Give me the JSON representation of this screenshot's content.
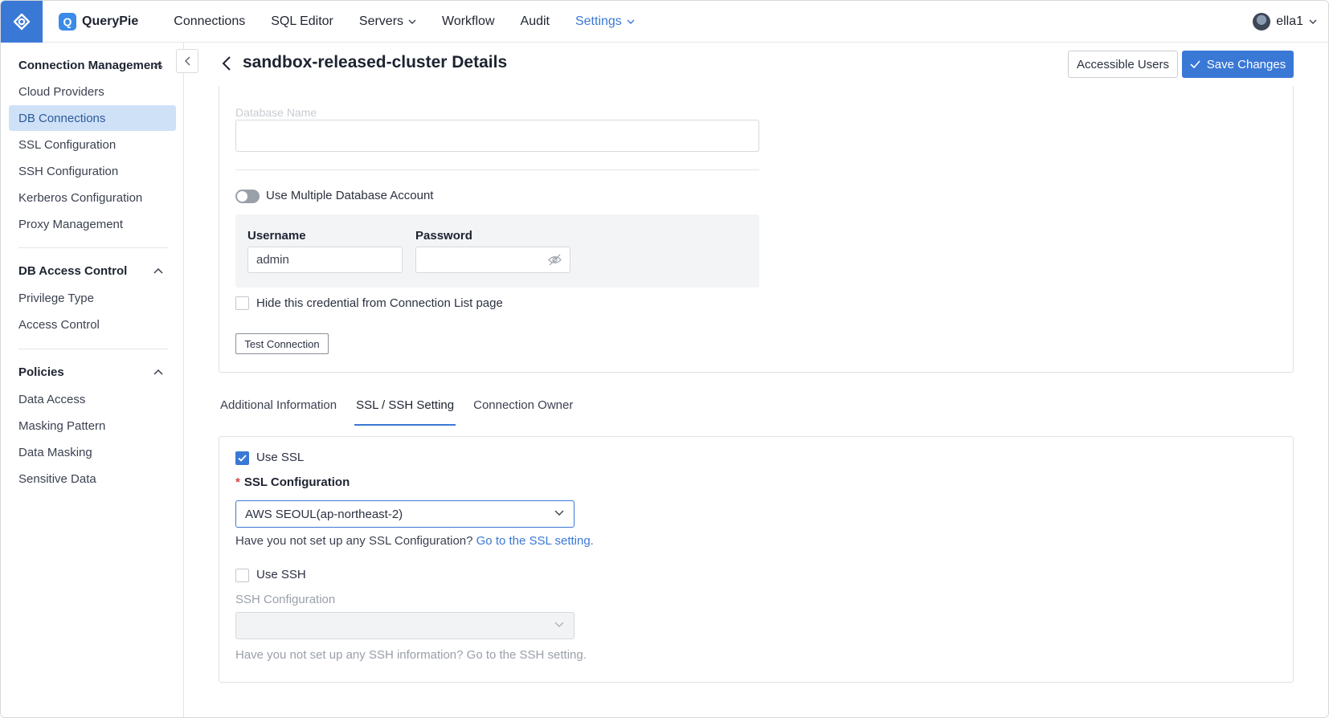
{
  "nav": {
    "brand": "QueryPie",
    "brand_logo_letter": "Q",
    "items": [
      "Connections",
      "SQL Editor",
      "Servers",
      "Workflow",
      "Audit",
      "Settings"
    ],
    "user": "ella1"
  },
  "sidebar": {
    "groups": [
      {
        "title": "Connection Management",
        "items": [
          "Cloud Providers",
          "DB Connections",
          "SSL Configuration",
          "SSH Configuration",
          "Kerberos Configuration",
          "Proxy Management"
        ]
      },
      {
        "title": "DB Access Control",
        "items": [
          "Privilege Type",
          "Access Control"
        ]
      },
      {
        "title": "Policies",
        "items": [
          "Data Access",
          "Masking Pattern",
          "Data Masking",
          "Sensitive Data"
        ]
      }
    ],
    "selected": "DB Connections"
  },
  "header": {
    "title": "sandbox-released-cluster Details",
    "accessible_users": "Accessible Users",
    "save_changes": "Save Changes"
  },
  "form": {
    "database_name_label": "Database Name",
    "use_multiple_account": "Use Multiple Database Account",
    "username_label": "Username",
    "username_value": "admin",
    "password_label": "Password",
    "hide_credential": "Hide this credential from Connection List page",
    "test_connection": "Test Connection"
  },
  "tabs": [
    "Additional Information",
    "SSL / SSH Setting",
    "Connection Owner"
  ],
  "active_tab": "SSL / SSH Setting",
  "ssl": {
    "use_ssl": "Use SSL",
    "use_ssl_checked": true,
    "config_label": "SSL Configuration",
    "config_value": "AWS SEOUL(ap-northeast-2)",
    "help_text": "Have you not set up any SSL Configuration?",
    "help_link": "Go to the SSL setting."
  },
  "ssh": {
    "use_ssh": "Use SSH",
    "use_ssh_checked": false,
    "config_label": "SSH Configuration",
    "help_text": "Have you not set up any SSH information? Go to the SSH setting."
  },
  "colors": {
    "accent": "#3a78d6",
    "selected_bg": "#cfe1f7"
  }
}
